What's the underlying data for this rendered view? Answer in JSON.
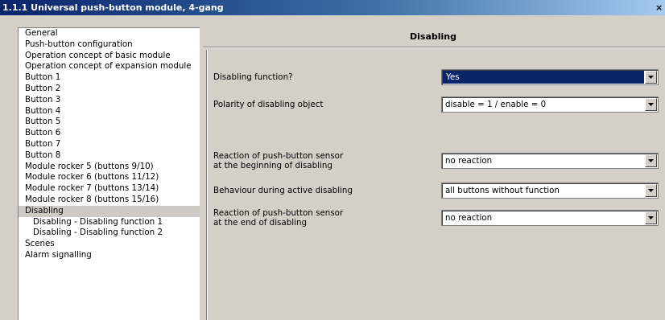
{
  "window": {
    "title": "1.1.1 Universal push-button module, 4-gang",
    "close_glyph": "×"
  },
  "tree": {
    "items": [
      {
        "label": "General"
      },
      {
        "label": "Push-button configuration"
      },
      {
        "label": "Operation concept of basic module"
      },
      {
        "label": "Operation concept of expansion module"
      },
      {
        "label": "Button 1"
      },
      {
        "label": "Button 2"
      },
      {
        "label": "Button 3"
      },
      {
        "label": "Button 4"
      },
      {
        "label": "Button 5"
      },
      {
        "label": "Button 6"
      },
      {
        "label": "Button 7"
      },
      {
        "label": "Button 8"
      },
      {
        "label": "Module rocker 5 (buttons 9/10)"
      },
      {
        "label": "Module rocker 6 (buttons 11/12)"
      },
      {
        "label": "Module rocker 7 (buttons 13/14)"
      },
      {
        "label": "Module rocker 8 (buttons 15/16)"
      },
      {
        "label": "Disabling",
        "selected": true
      },
      {
        "label": "Disabling - Disabling function 1",
        "sub": true
      },
      {
        "label": "Disabling - Disabling function 2",
        "sub": true
      },
      {
        "label": "Scenes"
      },
      {
        "label": "Alarm signalling"
      }
    ]
  },
  "panel": {
    "title": "Disabling",
    "params": {
      "disabling_function": {
        "label": "Disabling function?",
        "value": "Yes"
      },
      "polarity": {
        "label": "Polarity of disabling object",
        "value": "disable = 1 / enable = 0"
      },
      "reaction_begin": {
        "label_line1": "Reaction of push-button sensor",
        "label_line2": "at the beginning of disabling",
        "value": "no reaction"
      },
      "behaviour_active": {
        "label": "Behaviour during active disabling",
        "value": "all buttons without function"
      },
      "reaction_end": {
        "label_line1": "Reaction of push-button sensor",
        "label_line2": "at the end of disabling",
        "value": "no reaction"
      }
    }
  },
  "colors": {
    "selection_highlight": "#0a246a",
    "tree_selected": "#cfc9c3",
    "dialog_bg": "#d4d0c8"
  }
}
